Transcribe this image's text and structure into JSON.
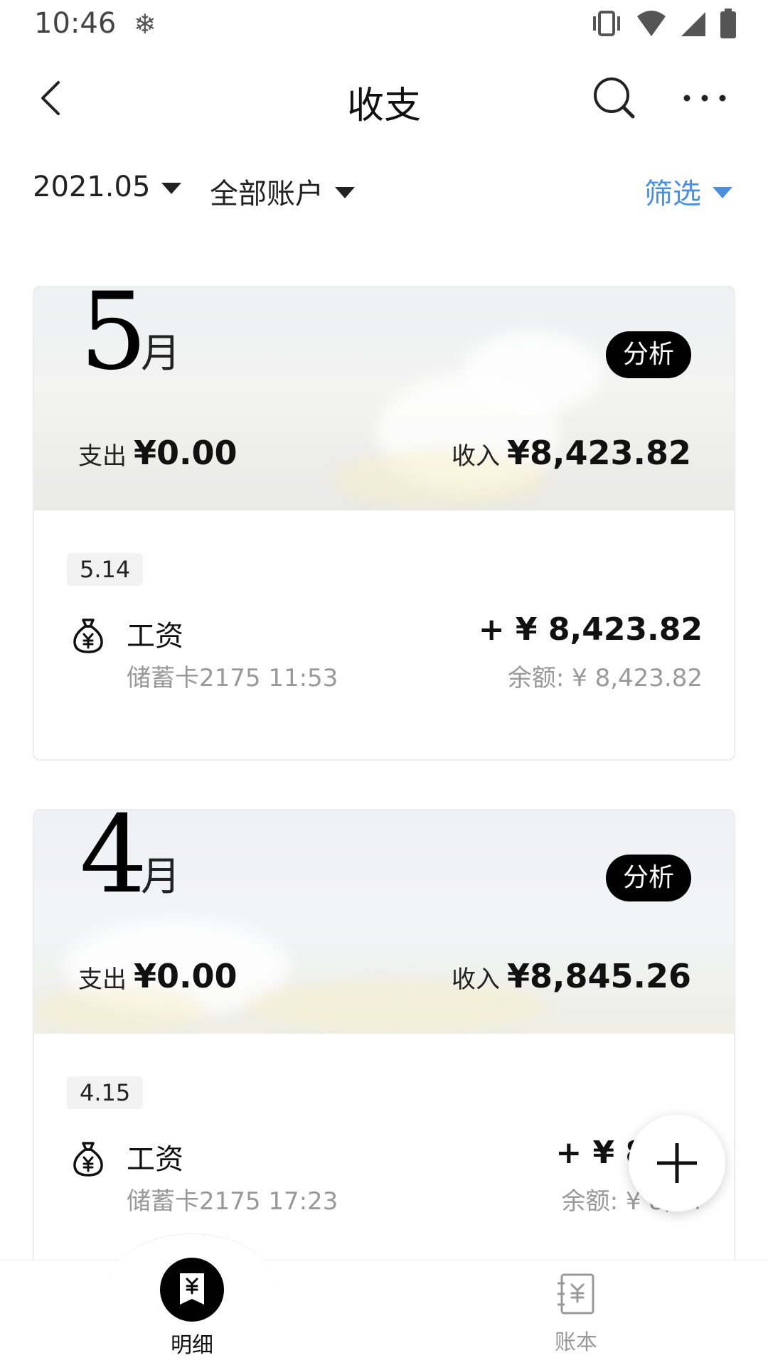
{
  "status_bar": {
    "time": "10:46",
    "snow_glyph": "❄",
    "icons": [
      "vibrate-icon",
      "wifi-icon",
      "signal-icon",
      "battery-icon"
    ]
  },
  "app_bar": {
    "title": "收支",
    "icons": [
      "back-icon",
      "search-icon",
      "more-icon"
    ]
  },
  "filters": {
    "month": "2021.05",
    "account": "全部账户",
    "screen": "筛选",
    "accent_color": "#4a8fe0"
  },
  "months": [
    {
      "num": "5",
      "unit": "月",
      "analyze_label": "分析",
      "expense_label": "支出",
      "expense_value": "¥0.00",
      "income_label": "收入",
      "income_value": "¥8,423.82",
      "date_badge": "5.14",
      "txn": {
        "name": "工资",
        "sub": "储蓄卡2175 11:53",
        "amount": "+ ¥ 8,423.82",
        "balance": "余额: ¥ 8,423.82",
        "icon": "money-bag-icon"
      }
    },
    {
      "num": "4",
      "unit": "月",
      "analyze_label": "分析",
      "expense_label": "支出",
      "expense_value": "¥0.00",
      "income_label": "收入",
      "income_value": "¥8,845.26",
      "date_badge": "4.15",
      "txn": {
        "name": "工资",
        "sub": "储蓄卡2175 17:23",
        "amount": "+ ¥ 8,84",
        "balance": "余额: ¥ 8,84",
        "icon": "money-bag-icon"
      }
    }
  ],
  "fab": {
    "icon": "plus-icon"
  },
  "bottom_nav": [
    {
      "label": "明细",
      "icon": "receipt-icon",
      "active": true
    },
    {
      "label": "账本",
      "icon": "ledger-icon",
      "active": false
    }
  ]
}
